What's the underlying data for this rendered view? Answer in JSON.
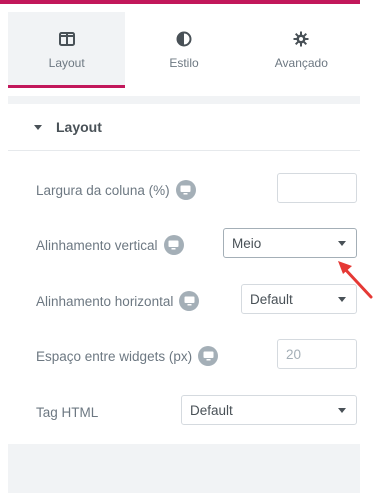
{
  "tabs": [
    {
      "label": "Layout",
      "icon": "columns-icon",
      "active": true
    },
    {
      "label": "Estilo",
      "icon": "contrast-icon",
      "active": false
    },
    {
      "label": "Avançado",
      "icon": "gear-icon",
      "active": false
    }
  ],
  "section": {
    "title": "Layout"
  },
  "fields": {
    "column_width": {
      "label": "Largura da coluna (%)",
      "value": ""
    },
    "vertical_align": {
      "label": "Alinhamento vertical",
      "value": "Meio"
    },
    "horizontal_align": {
      "label": "Alinhamento horizontal",
      "value": "Default"
    },
    "widgets_space": {
      "label": "Espaço entre widgets (px)",
      "placeholder": "20"
    },
    "html_tag": {
      "label": "Tag HTML",
      "value": "Default"
    }
  },
  "colors": {
    "accent": "#c2185b",
    "arrow": "#e53935"
  }
}
